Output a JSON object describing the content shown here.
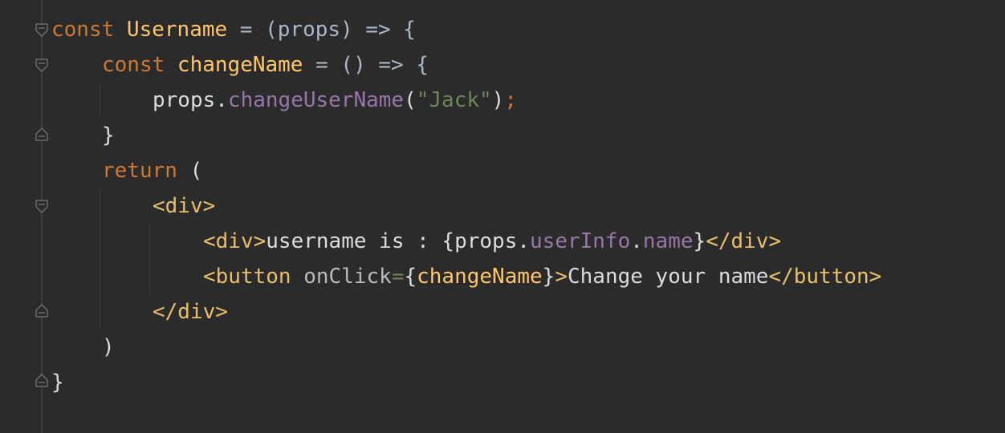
{
  "editor": {
    "lines": [
      [
        {
          "t": "const ",
          "c": "kw"
        },
        {
          "t": "Username",
          "c": "fn"
        },
        {
          "t": " = (props) => {",
          "c": "plain"
        }
      ],
      [
        {
          "t": "const ",
          "c": "kw"
        },
        {
          "t": "changeName",
          "c": "fn"
        },
        {
          "t": " = () => {",
          "c": "plain"
        }
      ],
      [
        {
          "t": "props.",
          "c": "text"
        },
        {
          "t": "changeUserName",
          "c": "prop"
        },
        {
          "t": "(",
          "c": "text"
        },
        {
          "t": "\"Jack\"",
          "c": "str"
        },
        {
          "t": ")",
          "c": "text"
        },
        {
          "t": ";",
          "c": "kw"
        }
      ],
      [
        {
          "t": "}",
          "c": "text"
        }
      ],
      [
        {
          "t": "return ",
          "c": "kw"
        },
        {
          "t": "(",
          "c": "text"
        }
      ],
      [
        {
          "t": "<div>",
          "c": "tag"
        }
      ],
      [
        {
          "t": "<div>",
          "c": "tag"
        },
        {
          "t": "username is : {props.",
          "c": "text"
        },
        {
          "t": "userInfo",
          "c": "prop"
        },
        {
          "t": ".",
          "c": "text"
        },
        {
          "t": "name",
          "c": "prop"
        },
        {
          "t": "}",
          "c": "text"
        },
        {
          "t": "</div>",
          "c": "tag"
        }
      ],
      [
        {
          "t": "<button ",
          "c": "tag"
        },
        {
          "t": "onClick",
          "c": "attr"
        },
        {
          "t": "=",
          "c": "str"
        },
        {
          "t": "{",
          "c": "text"
        },
        {
          "t": "changeName",
          "c": "fn"
        },
        {
          "t": "}",
          "c": "text"
        },
        {
          "t": ">",
          "c": "tag"
        },
        {
          "t": "Change your name",
          "c": "text"
        },
        {
          "t": "</button>",
          "c": "tag"
        }
      ],
      [
        {
          "t": "</div>",
          "c": "tag"
        }
      ],
      [
        {
          "t": ")",
          "c": "text"
        }
      ],
      [
        {
          "t": "}",
          "c": "text"
        }
      ]
    ]
  }
}
